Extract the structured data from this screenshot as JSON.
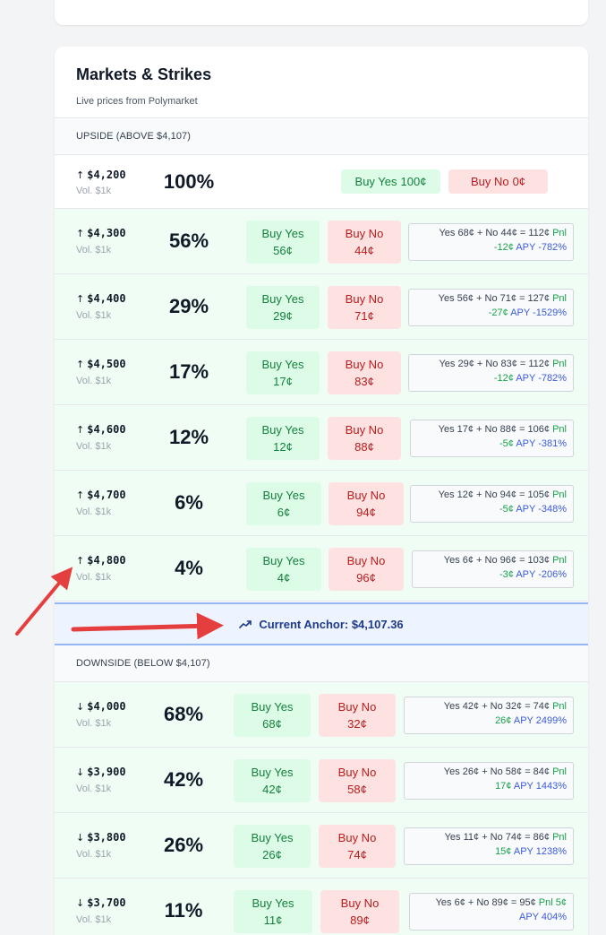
{
  "card": {
    "title": "Markets & Strikes",
    "subtitle": "Live prices from Polymarket"
  },
  "upside": {
    "header": "UPSIDE (ABOVE $4,107)",
    "arrow": "↑",
    "rows": [
      {
        "strike": "$4,200",
        "vol": "Vol. $1k",
        "pct": "100%",
        "yes_label": "Buy Yes",
        "yes_price": "100¢",
        "no_label": "Buy No",
        "no_price": "0¢"
      },
      {
        "strike": "$4,300",
        "vol": "Vol. $1k",
        "pct": "56%",
        "yes_label": "Buy Yes",
        "yes_price": "56¢",
        "no_label": "Buy No",
        "no_price": "44¢",
        "calc_line": "Yes 68¢ + No 44¢ = 112¢",
        "pnl_label": "Pnl",
        "pnl_value": "-12¢",
        "apy": "APY -782%"
      },
      {
        "strike": "$4,400",
        "vol": "Vol. $1k",
        "pct": "29%",
        "yes_label": "Buy Yes",
        "yes_price": "29¢",
        "no_label": "Buy No",
        "no_price": "71¢",
        "calc_line": "Yes 56¢ + No 71¢ = 127¢",
        "pnl_label": "Pnl",
        "pnl_value": "-27¢",
        "apy": "APY -1529%"
      },
      {
        "strike": "$4,500",
        "vol": "Vol. $1k",
        "pct": "17%",
        "yes_label": "Buy Yes",
        "yes_price": "17¢",
        "no_label": "Buy No",
        "no_price": "83¢",
        "calc_line": "Yes 29¢ + No 83¢ = 112¢",
        "pnl_label": "Pnl",
        "pnl_value": "-12¢",
        "apy": "APY -782%"
      },
      {
        "strike": "$4,600",
        "vol": "Vol. $1k",
        "pct": "12%",
        "yes_label": "Buy Yes",
        "yes_price": "12¢",
        "no_label": "Buy No",
        "no_price": "88¢",
        "calc_line": "Yes 17¢ + No 88¢ = 106¢",
        "pnl_label": "Pnl",
        "pnl_value": "-5¢",
        "apy": "APY -381%"
      },
      {
        "strike": "$4,700",
        "vol": "Vol. $1k",
        "pct": "6%",
        "yes_label": "Buy Yes",
        "yes_price": "6¢",
        "no_label": "Buy No",
        "no_price": "94¢",
        "calc_line": "Yes 12¢ + No 94¢ = 105¢",
        "pnl_label": "Pnl",
        "pnl_value": "-5¢",
        "apy": "APY -348%"
      },
      {
        "strike": "$4,800",
        "vol": "Vol. $1k",
        "pct": "4%",
        "yes_label": "Buy Yes",
        "yes_price": "4¢",
        "no_label": "Buy No",
        "no_price": "96¢",
        "calc_line": "Yes 6¢ + No 96¢ = 103¢",
        "pnl_label": "Pnl",
        "pnl_value": "-3¢",
        "apy": "APY -206%"
      }
    ]
  },
  "anchor": {
    "label": "Current Anchor: $4,107.36",
    "icon": "trending-up-icon"
  },
  "downside": {
    "header": "DOWNSIDE (BELOW $4,107)",
    "arrow": "↓",
    "rows": [
      {
        "strike": "$4,000",
        "vol": "Vol. $1k",
        "pct": "68%",
        "yes_label": "Buy Yes",
        "yes_price": "68¢",
        "no_label": "Buy No",
        "no_price": "32¢",
        "calc_line": "Yes 42¢ + No 32¢ = 74¢",
        "pnl_label": "Pnl",
        "pnl_value": "26¢",
        "apy": "APY 2499%"
      },
      {
        "strike": "$3,900",
        "vol": "Vol. $1k",
        "pct": "42%",
        "yes_label": "Buy Yes",
        "yes_price": "42¢",
        "no_label": "Buy No",
        "no_price": "58¢",
        "calc_line": "Yes 26¢ + No 58¢ = 84¢",
        "pnl_label": "Pnl",
        "pnl_value": "17¢",
        "apy": "APY 1443%"
      },
      {
        "strike": "$3,800",
        "vol": "Vol. $1k",
        "pct": "26%",
        "yes_label": "Buy Yes",
        "yes_price": "26¢",
        "no_label": "Buy No",
        "no_price": "74¢",
        "calc_line": "Yes 11¢ + No 74¢ = 86¢",
        "pnl_label": "Pnl",
        "pnl_value": "15¢",
        "apy": "APY 1238%"
      },
      {
        "strike": "$3,700",
        "vol": "Vol. $1k",
        "pct": "11%",
        "yes_label": "Buy Yes",
        "yes_price": "11¢",
        "no_label": "Buy No",
        "no_price": "89¢",
        "calc_line": "Yes 6¢ + No 89¢ = 95¢",
        "pnl_label": "Pnl 5¢",
        "apy": "APY 404%"
      }
    ]
  },
  "colors": {
    "row_bg": "#f0fdf4",
    "yes_bg": "#dcfce7",
    "yes_text": "#15803d",
    "no_bg": "#fee2e2",
    "no_text": "#b91c1c",
    "pnl": "#16a34a",
    "apy": "#3b5bdb",
    "anchor_bg": "#eef4ff",
    "annotation": "#e53e3e"
  }
}
